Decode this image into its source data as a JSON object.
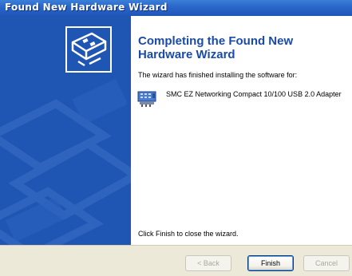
{
  "window": {
    "title": "Found New Hardware Wizard"
  },
  "main": {
    "heading": "Completing the Found New Hardware Wizard",
    "description": "The wizard has finished installing the software for:",
    "device_name": "SMC EZ Networking Compact 10/100 USB 2.0 Adapter",
    "footer_text": "Click Finish to close the wizard."
  },
  "buttons": {
    "back": "< Back",
    "finish": "Finish",
    "cancel": "Cancel"
  },
  "icons": {
    "wizard_logo": "hardware-wizard-icon",
    "device": "network-adapter-icon"
  },
  "colors": {
    "titlebar": "#2a65c8",
    "side_panel": "#1f55b3",
    "heading": "#1a4ba8",
    "button_bar": "#ece9d8"
  }
}
